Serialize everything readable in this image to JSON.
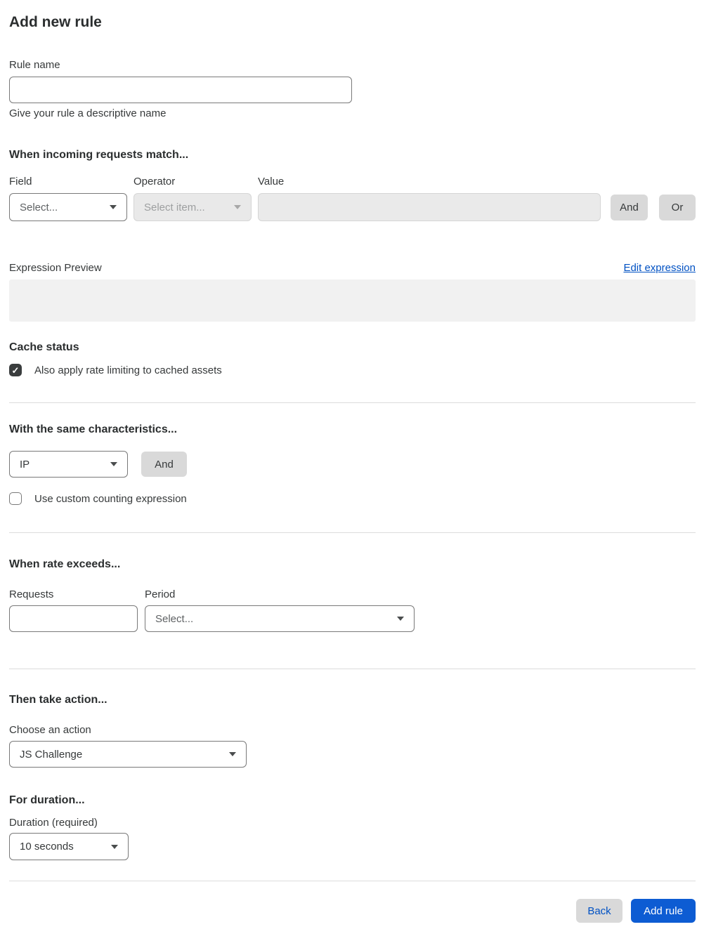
{
  "page": {
    "title": "Add new rule"
  },
  "rule_name": {
    "label": "Rule name",
    "value": "",
    "helper": "Give your rule a descriptive name"
  },
  "match_section": {
    "heading": "When incoming requests match...",
    "field": {
      "label": "Field",
      "placeholder": "Select..."
    },
    "operator": {
      "label": "Operator",
      "placeholder": "Select item..."
    },
    "value": {
      "label": "Value",
      "value": ""
    },
    "and_label": "And",
    "or_label": "Or",
    "expression_preview_label": "Expression Preview",
    "edit_expression_label": "Edit expression",
    "expression_value": ""
  },
  "cache_status": {
    "heading": "Cache status",
    "checkbox_label": "Also apply rate limiting to cached assets",
    "checked": true,
    "check_glyph": "✓"
  },
  "characteristics": {
    "heading": "With the same characteristics...",
    "selected_value": "IP",
    "and_label": "And",
    "checkbox_label": "Use custom counting expression",
    "checked": false
  },
  "rate_section": {
    "heading": "When rate exceeds...",
    "requests_label": "Requests",
    "requests_value": "",
    "period_label": "Period",
    "period_placeholder": "Select..."
  },
  "action_section": {
    "heading": "Then take action...",
    "label": "Choose an action",
    "selected_value": "JS Challenge"
  },
  "duration_section": {
    "heading": "For duration...",
    "label": "Duration (required)",
    "selected_value": "10 seconds"
  },
  "footer": {
    "back_label": "Back",
    "add_rule_label": "Add rule"
  },
  "colors": {
    "primary_button_blue": "#0d5cd3",
    "link_blue": "#0051c3",
    "text_dark": "#36393a",
    "disabled_bg": "#e9e9e9",
    "gray_button_bg": "#d9d9d9",
    "expression_box_bg": "#f1f1f1"
  }
}
